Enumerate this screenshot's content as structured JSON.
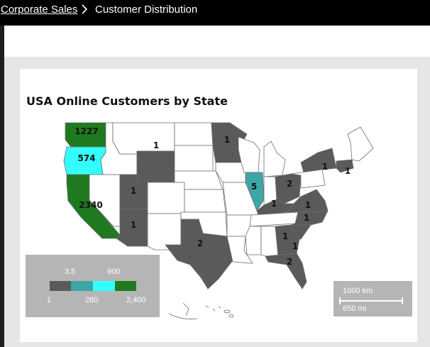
{
  "breadcrumb": {
    "parent": "Corporate Sales",
    "current": "Customer Distribution"
  },
  "map": {
    "title": "USA Online Customers by State",
    "states": [
      {
        "name": "Washington",
        "value": "1227",
        "color": "#1f7a1f"
      },
      {
        "name": "Oregon",
        "value": "574",
        "color": "#33ffff"
      },
      {
        "name": "California",
        "value": "2340",
        "color": "#1f7a1f"
      },
      {
        "name": "Nevada",
        "value": "",
        "color": "#ffffff"
      },
      {
        "name": "Idaho",
        "value": "",
        "color": "#ffffff"
      },
      {
        "name": "Montana",
        "value": "",
        "color": "#ffffff"
      },
      {
        "name": "Wyoming",
        "value": "1",
        "color": "#5a5a5a"
      },
      {
        "name": "Utah",
        "value": "1",
        "color": "#5a5a5a"
      },
      {
        "name": "Arizona",
        "value": "1",
        "color": "#5a5a5a"
      },
      {
        "name": "Colorado",
        "value": "",
        "color": "#ffffff"
      },
      {
        "name": "New Mexico",
        "value": "",
        "color": "#ffffff"
      },
      {
        "name": "North Dakota",
        "value": "",
        "color": "#ffffff"
      },
      {
        "name": "South Dakota",
        "value": "",
        "color": "#ffffff"
      },
      {
        "name": "Nebraska",
        "value": "",
        "color": "#ffffff"
      },
      {
        "name": "Kansas",
        "value": "",
        "color": "#ffffff"
      },
      {
        "name": "Oklahoma",
        "value": "",
        "color": "#ffffff"
      },
      {
        "name": "Texas",
        "value": "2",
        "color": "#5a5a5a"
      },
      {
        "name": "Minnesota",
        "value": "1",
        "color": "#5a5a5a"
      },
      {
        "name": "Iowa",
        "value": "",
        "color": "#ffffff"
      },
      {
        "name": "Missouri",
        "value": "",
        "color": "#ffffff"
      },
      {
        "name": "Arkansas",
        "value": "",
        "color": "#ffffff"
      },
      {
        "name": "Louisiana",
        "value": "",
        "color": "#ffffff"
      },
      {
        "name": "Wisconsin",
        "value": "",
        "color": "#ffffff"
      },
      {
        "name": "Illinois",
        "value": "5",
        "color": "#3da6a6"
      },
      {
        "name": "Michigan",
        "value": "",
        "color": "#ffffff"
      },
      {
        "name": "Indiana",
        "value": "",
        "color": "#ffffff"
      },
      {
        "name": "Ohio",
        "value": "2",
        "color": "#5a5a5a"
      },
      {
        "name": "Kentucky",
        "value": "1",
        "color": "#5a5a5a"
      },
      {
        "name": "Tennessee",
        "value": "",
        "color": "#ffffff"
      },
      {
        "name": "Mississippi",
        "value": "",
        "color": "#ffffff"
      },
      {
        "name": "Alabama",
        "value": "",
        "color": "#ffffff"
      },
      {
        "name": "Georgia",
        "value": "1",
        "color": "#5a5a5a"
      },
      {
        "name": "South Carolina",
        "value": "1",
        "color": "#5a5a5a"
      },
      {
        "name": "North Carolina",
        "value": "1",
        "color": "#5a5a5a"
      },
      {
        "name": "Virginia",
        "value": "1",
        "color": "#5a5a5a"
      },
      {
        "name": "Florida",
        "value": "2",
        "color": "#5a5a5a"
      },
      {
        "name": "New York",
        "value": "1",
        "color": "#5a5a5a"
      },
      {
        "name": "Massachusetts",
        "value": "1",
        "color": "#5a5a5a"
      },
      {
        "name": "Pennsylvania",
        "value": "",
        "color": "#ffffff"
      },
      {
        "name": "Maine",
        "value": "",
        "color": "#ffffff"
      }
    ]
  },
  "legend": {
    "top_labels": [
      "3.5",
      "900"
    ],
    "bottom_labels": [
      "1",
      "280",
      "2,400"
    ],
    "colors": [
      "#5a5a5a",
      "#3da6a6",
      "#33ffff",
      "#1f7a1f"
    ]
  },
  "scale": {
    "km": "1000 km",
    "mi": "650 mi"
  }
}
